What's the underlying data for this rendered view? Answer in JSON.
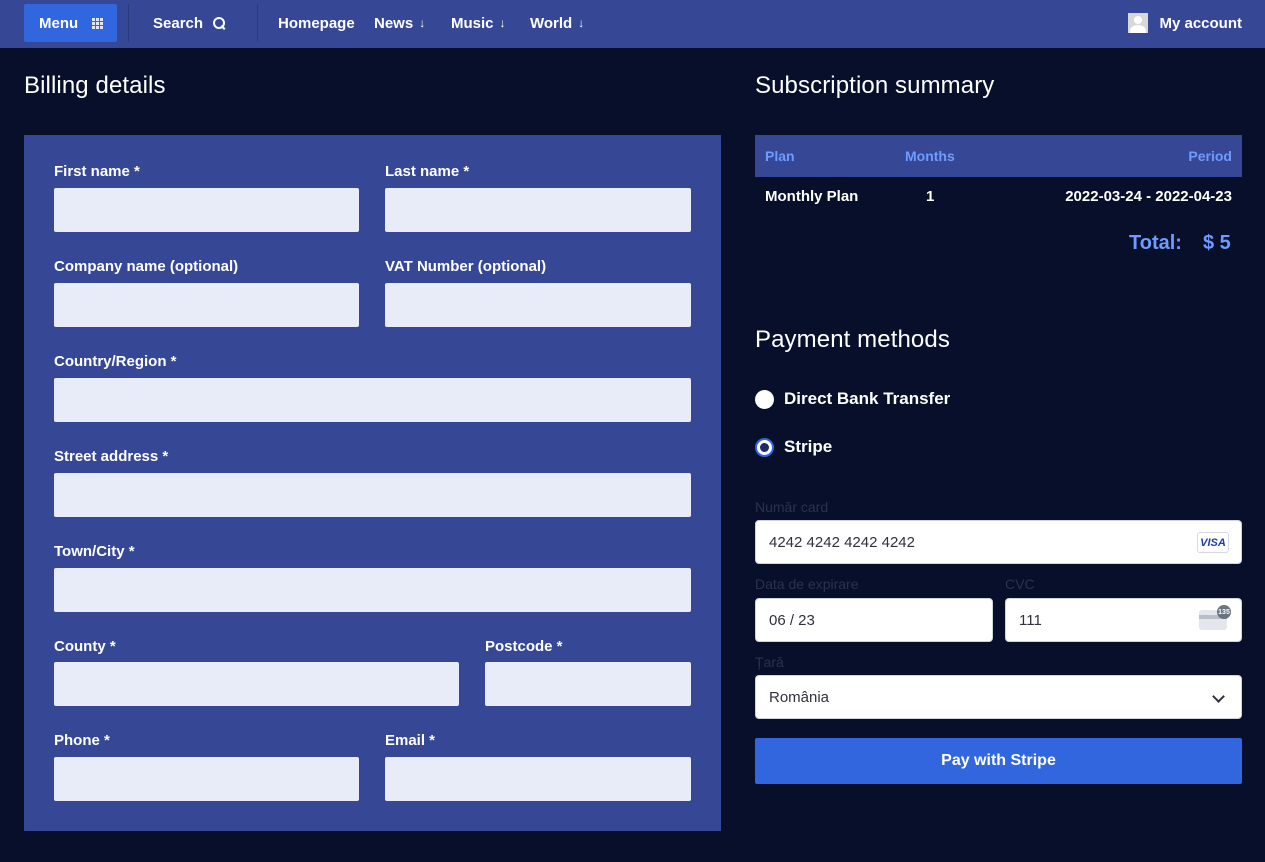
{
  "nav": {
    "menu_label": "Menu",
    "search_label": "Search",
    "links": [
      "Homepage",
      "News",
      "Music",
      "World"
    ],
    "account_label": "My account"
  },
  "billing": {
    "title": "Billing details",
    "fields": {
      "first_name": "First name *",
      "last_name": "Last name *",
      "company": "Company name (optional)",
      "vat": "VAT Number (optional)",
      "country": "Country/Region *",
      "street": "Street address *",
      "town": "Town/City *",
      "county": "County *",
      "postcode": "Postcode *",
      "phone": "Phone *",
      "email": "Email *"
    }
  },
  "summary": {
    "title": "Subscription summary",
    "headers": [
      "Plan",
      "Months",
      "Period"
    ],
    "row": {
      "plan": "Monthly Plan",
      "months": "1",
      "period": "2022-03-24 - 2022-04-23"
    },
    "total_label": "Total:",
    "total_value": "$ 5"
  },
  "payment": {
    "title": "Payment methods",
    "methods": [
      {
        "label": "Direct Bank Transfer",
        "selected": false
      },
      {
        "label": "Stripe",
        "selected": true
      }
    ],
    "stripe": {
      "card_number_label": "Număr card",
      "card_number_value": "4242 4242 4242 4242",
      "card_brand": "VISA",
      "expiry_label": "Data de expirare",
      "expiry_value": "06 / 23",
      "cvc_label": "CVC",
      "cvc_value": "111",
      "cvc_icon_text": "135",
      "country_label": "Țară",
      "country_value": "România"
    },
    "pay_button": "Pay with Stripe"
  },
  "colors": {
    "background": "#070f2b",
    "nav": "#364895",
    "panel": "#364895",
    "accent": "#3166de",
    "header_text": "#6e9bff",
    "input": "#e8ebf8"
  }
}
